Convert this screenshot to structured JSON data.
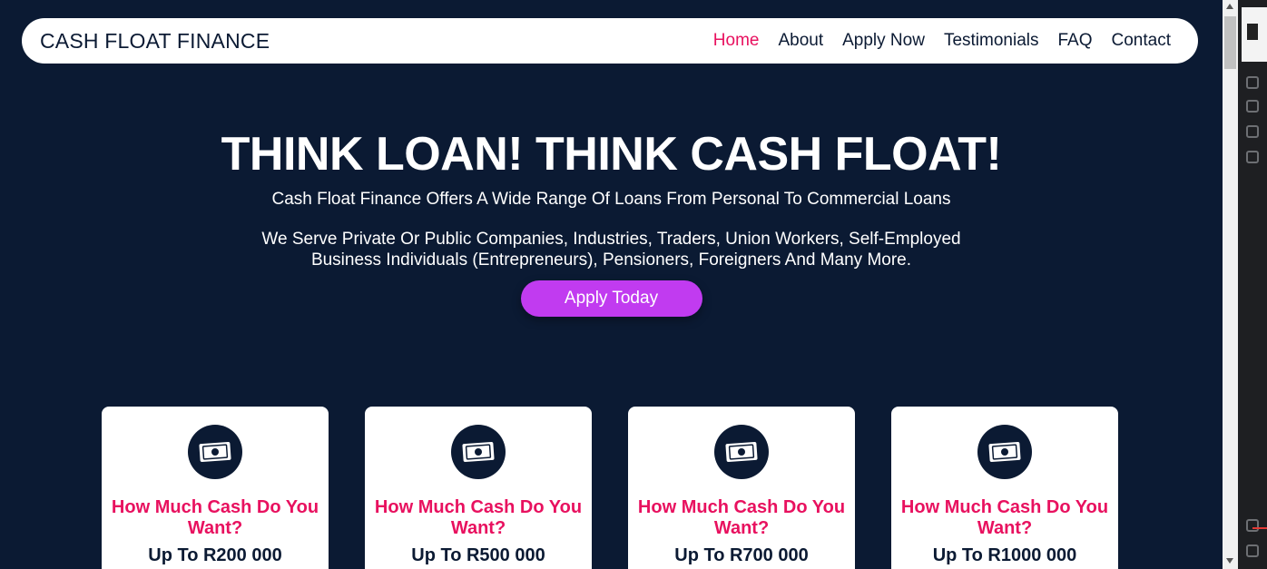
{
  "navbar": {
    "brand": "CASH FLOAT FINANCE",
    "links": [
      "Home",
      "About",
      "Apply Now",
      "Testimonials",
      "FAQ",
      "Contact"
    ]
  },
  "hero": {
    "title": "THINK LOAN! THINK CASH FLOAT!",
    "subtitle": "Cash Float Finance Offers A Wide Range Of Loans From Personal To Commercial Loans",
    "description": "We Serve Private Or Public Companies, Industries, Traders, Union Workers, Self-Employed Business Individuals (Entrepreneurs), Pensioners, Foreigners And Many More.",
    "cta_label": "Apply Today"
  },
  "cards": [
    {
      "question": "How Much Cash Do You Want?",
      "amount": "Up To R200 000",
      "icon": "money-bill-icon"
    },
    {
      "question": "How Much Cash Do You Want?",
      "amount": "Up To R500 000",
      "icon": "money-bill-icon"
    },
    {
      "question": "How Much Cash Do You Want?",
      "amount": "Up To R700 000",
      "icon": "money-bill-icon"
    },
    {
      "question": "How Much Cash Do You Want?",
      "amount": "Up To R1000 000",
      "icon": "money-bill-icon"
    }
  ],
  "colors": {
    "background": "#0b1a33",
    "accent_pink": "#e8115f",
    "cta_purple": "#c13bf0"
  }
}
